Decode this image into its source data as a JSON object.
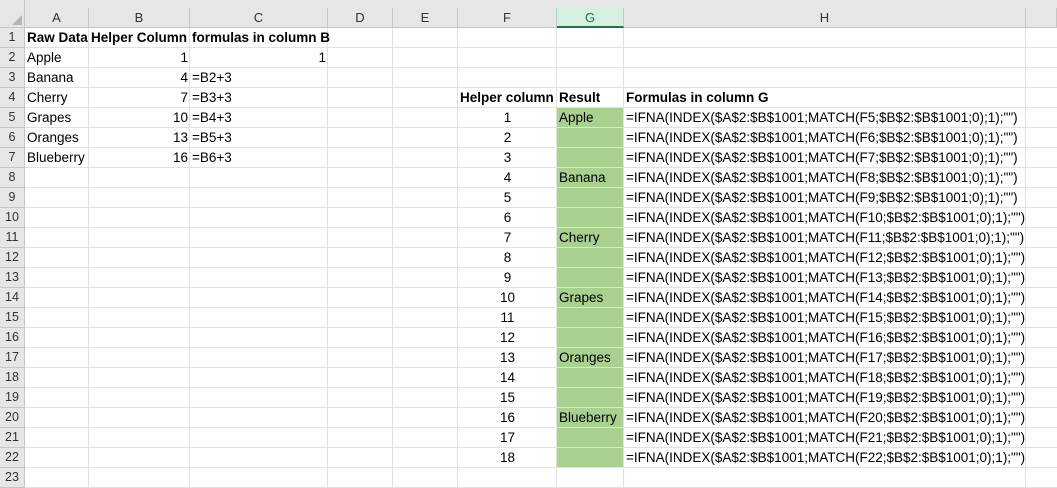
{
  "columns": [
    "A",
    "B",
    "C",
    "D",
    "E",
    "F",
    "G",
    "H"
  ],
  "selected_column": "G",
  "row_numbers": [
    "1",
    "2",
    "3",
    "4",
    "5",
    "6",
    "7",
    "8",
    "9",
    "10",
    "11",
    "12",
    "13",
    "14",
    "15",
    "16",
    "17",
    "18",
    "19",
    "20",
    "21",
    "22",
    "23"
  ],
  "headers": {
    "raw_data": "Raw Data",
    "helper_column": "Helper Column",
    "formulas_b": "formulas in column B",
    "helper_column_f": "Helper column",
    "result": "Result",
    "formulas_g": "Formulas in column G"
  },
  "raw_data": [
    "Apple",
    "Banana",
    "Cherry",
    "Grapes",
    "Oranges",
    "Blueberry"
  ],
  "helper_values": [
    "1",
    "4",
    "7",
    "10",
    "13",
    "16"
  ],
  "c2_value": "1",
  "formulas_b": [
    "=B2+3",
    "=B3+3",
    "=B4+3",
    "=B5+3",
    "=B6+3"
  ],
  "helper_f": [
    "1",
    "2",
    "3",
    "4",
    "5",
    "6",
    "7",
    "8",
    "9",
    "10",
    "11",
    "12",
    "13",
    "14",
    "15",
    "16",
    "17",
    "18"
  ],
  "result": [
    "Apple",
    "",
    "",
    "Banana",
    "",
    "",
    "Cherry",
    "",
    "",
    "Grapes",
    "",
    "",
    "Oranges",
    "",
    "",
    "Blueberry",
    "",
    ""
  ],
  "formulas_g": [
    "=IFNA(INDEX($A$2:$B$1001;MATCH(F5;$B$2:$B$1001;0);1);\"\")",
    "=IFNA(INDEX($A$2:$B$1001;MATCH(F6;$B$2:$B$1001;0);1);\"\")",
    "=IFNA(INDEX($A$2:$B$1001;MATCH(F7;$B$2:$B$1001;0);1);\"\")",
    "=IFNA(INDEX($A$2:$B$1001;MATCH(F8;$B$2:$B$1001;0);1);\"\")",
    "=IFNA(INDEX($A$2:$B$1001;MATCH(F9;$B$2:$B$1001;0);1);\"\")",
    "=IFNA(INDEX($A$2:$B$1001;MATCH(F10;$B$2:$B$1001;0);1);\"\")",
    "=IFNA(INDEX($A$2:$B$1001;MATCH(F11;$B$2:$B$1001;0);1);\"\")",
    "=IFNA(INDEX($A$2:$B$1001;MATCH(F12;$B$2:$B$1001;0);1);\"\")",
    "=IFNA(INDEX($A$2:$B$1001;MATCH(F13;$B$2:$B$1001;0);1);\"\")",
    "=IFNA(INDEX($A$2:$B$1001;MATCH(F14;$B$2:$B$1001;0);1);\"\")",
    "=IFNA(INDEX($A$2:$B$1001;MATCH(F15;$B$2:$B$1001;0);1);\"\")",
    "=IFNA(INDEX($A$2:$B$1001;MATCH(F16;$B$2:$B$1001;0);1);\"\")",
    "=IFNA(INDEX($A$2:$B$1001;MATCH(F17;$B$2:$B$1001;0);1);\"\")",
    "=IFNA(INDEX($A$2:$B$1001;MATCH(F18;$B$2:$B$1001;0);1);\"\")",
    "=IFNA(INDEX($A$2:$B$1001;MATCH(F19;$B$2:$B$1001;0);1);\"\")",
    "=IFNA(INDEX($A$2:$B$1001;MATCH(F20;$B$2:$B$1001;0);1);\"\")",
    "=IFNA(INDEX($A$2:$B$1001;MATCH(F21;$B$2:$B$1001;0);1);\"\")",
    "=IFNA(INDEX($A$2:$B$1001;MATCH(F22;$B$2:$B$1001;0);1);\"\")"
  ],
  "colors": {
    "result_fill": "#a9d08e",
    "header_bg": "#e6e6e6",
    "selected_header_bg": "#d3f0e0",
    "selected_header_text": "#217346",
    "gridline": "#e1e1e1"
  }
}
